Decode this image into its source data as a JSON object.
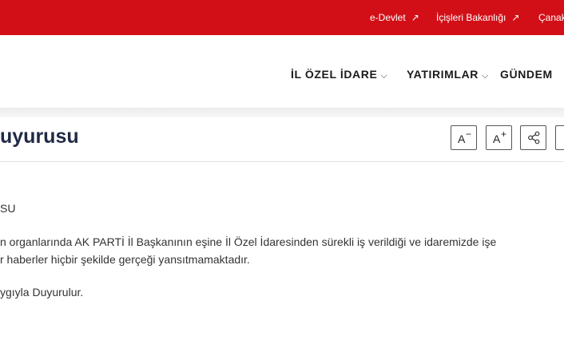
{
  "topbar": {
    "links": [
      {
        "label": "e-Devlet",
        "arrow": "↗"
      },
      {
        "label": "İçişleri Bakanlığı",
        "arrow": "↗"
      },
      {
        "label": "Çanak"
      }
    ]
  },
  "nav": {
    "items": [
      {
        "label": "İL ÖZEL İDARE",
        "chevron": "⌵"
      },
      {
        "label": "YATIRIMLAR",
        "chevron": "⌵"
      },
      {
        "label": "GÜNDEM"
      }
    ]
  },
  "article": {
    "title": "uyurusu",
    "tools": {
      "decrease_label": "A",
      "decrease_sup": "−",
      "increase_label": "A",
      "increase_sup": "+"
    },
    "body": {
      "heading": "SU",
      "line1": "n organlarında AK PARTİ İl Başkanının eşine İl Özel İdaresinden sürekli iş verildiği ve idaremizde işe",
      "line2": "r haberler hiçbir şekilde gerçeği yansıtmamaktadır.",
      "closing": "ygıyla Duyurulur."
    }
  },
  "colors": {
    "brand_red": "#d20f17",
    "title_navy": "#1f2a44"
  }
}
